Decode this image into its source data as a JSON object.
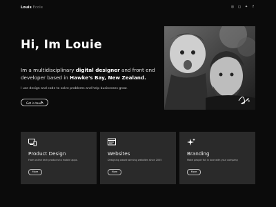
{
  "nav": {
    "logo_primary": "Louis",
    "logo_secondary": "Ecole",
    "socials": [
      "dribbble-icon",
      "instagram-icon",
      "twitter-icon",
      "facebook-icon"
    ]
  },
  "hero": {
    "title": "Hi, Im Louie",
    "intro_lead": "Im a multidisciplinary ",
    "intro_bold_1": "digital designer",
    "intro_mid": " and front end developer based in ",
    "intro_bold_2": "Hawke's Bay, New Zealand.",
    "subtitle": "I use design and code to solve problems and help businesses grow.",
    "cta_label": "Get in touch"
  },
  "cards": [
    {
      "title": "Product Design",
      "desc": "From online tech products to mobile apps.",
      "more": "More"
    },
    {
      "title": "Websites",
      "desc": "Designing award winning websites since 2005",
      "more": "More"
    },
    {
      "title": "Branding",
      "desc": "Make people fall in love with your company.",
      "more": "More"
    }
  ]
}
